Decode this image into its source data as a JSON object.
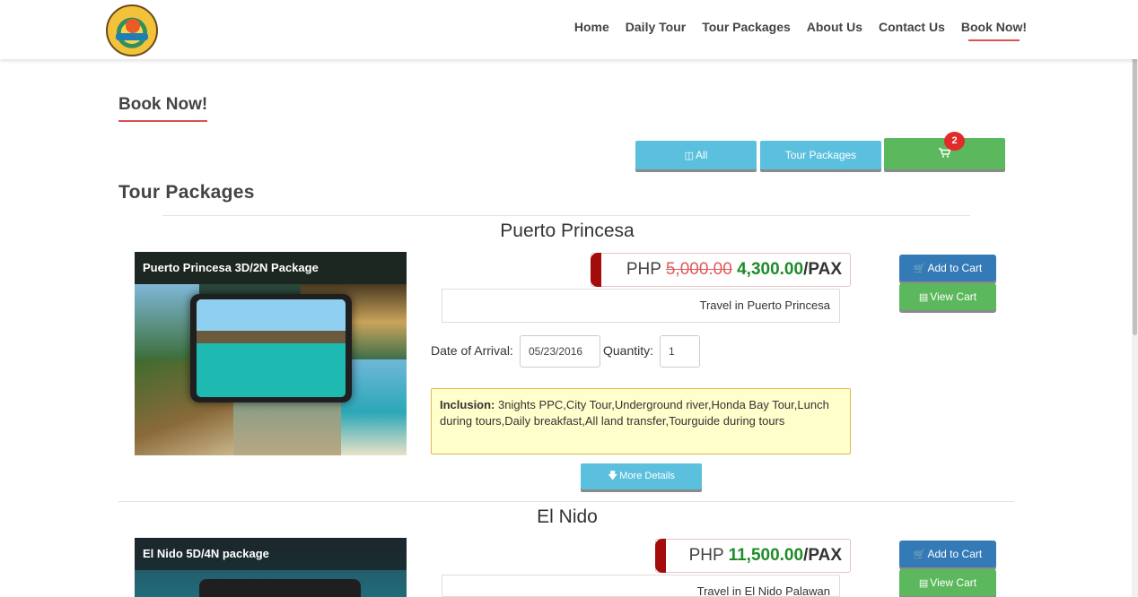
{
  "nav": {
    "items": [
      {
        "label": "Home"
      },
      {
        "label": "Daily Tour"
      },
      {
        "label": "Tour Packages"
      },
      {
        "label": "About Us"
      },
      {
        "label": "Contact Us"
      },
      {
        "label": "Book Now!",
        "active": true
      }
    ]
  },
  "page_title": "Book Now!",
  "filters": {
    "all_label": "All",
    "tour_packages_label": "Tour Packages",
    "cart_count": "2"
  },
  "section_title": "Tour Packages",
  "packages": [
    {
      "place": "Puerto Princesa",
      "image_label": "Puerto Princesa 3D/2N Package",
      "currency": "PHP",
      "old_price": "5,000.00",
      "price": "4,300.00",
      "unit": "/PAX",
      "travel": "Travel in Puerto Princesa",
      "date_label": "Date of Arrival:",
      "date_value": "05/23/2016",
      "qty_label": "Quantity:",
      "qty_value": "1",
      "inclusion_label": "Inclusion:",
      "inclusion_text": " 3nights PPC,City Tour,Underground river,Honda Bay Tour,Lunch during tours,Daily breakfast,All land transfer,Tourguide during tours",
      "more_label": "More Details",
      "add_label": "Add to Cart",
      "view_label": "View Cart"
    },
    {
      "place": "El Nido",
      "image_label": "El Nido 5D/4N package",
      "currency": "PHP",
      "price": "11,500.00",
      "unit": "/PAX",
      "travel": "Travel in El Nido Palawan",
      "add_label": "Add to Cart",
      "view_label": "View Cart"
    }
  ],
  "colors": {
    "accent_red": "#d9534f",
    "info_blue": "#5bc0de",
    "success_green": "#5cb85c",
    "primary_blue": "#337ab7",
    "price_green": "#1e8c2a",
    "badge_red": "#e12a2a"
  }
}
